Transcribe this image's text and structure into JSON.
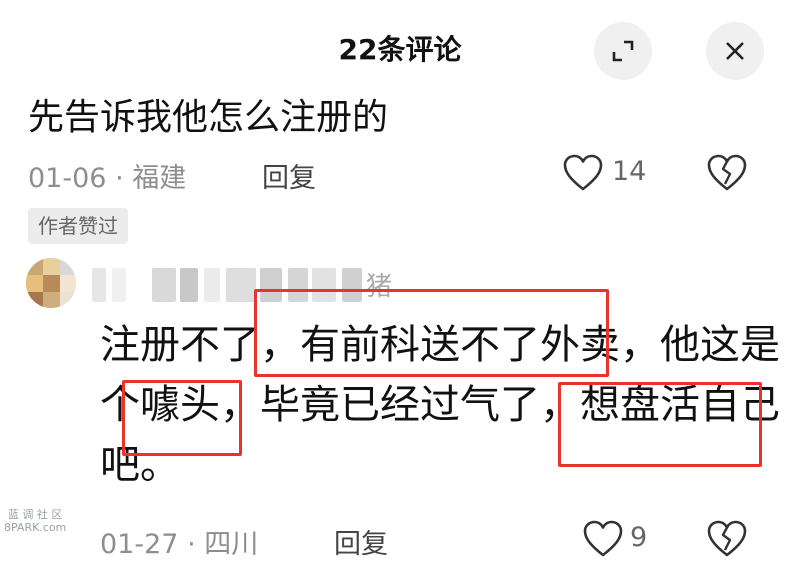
{
  "header": {
    "title": "22条评论"
  },
  "icons": {
    "expand": "expand-icon",
    "close": "close-icon",
    "like": "heart-outline-icon",
    "dislike": "broken-heart-icon"
  },
  "comments": [
    {
      "text": "先告诉我他怎么注册的",
      "date": "01-06",
      "location": "福建",
      "reply_label": "回复",
      "likes": "14"
    },
    {
      "badge": "作者赞过",
      "name_partial": "猪",
      "lines": [
        "注册不了，有前科送不了外卖，他这是",
        "个噱头，毕竟已经过气了，想盘活自己",
        "吧。"
      ],
      "date": "01-27",
      "location": "四川",
      "reply_label": "回复",
      "likes": "9"
    }
  ],
  "watermark": {
    "line1": "蓝 调 社 区",
    "line2": "8PARK.com"
  },
  "colors": {
    "highlight_box": "#e8342a",
    "meta_text": "#8e8e8e",
    "button_bg": "#f0f0f0"
  }
}
